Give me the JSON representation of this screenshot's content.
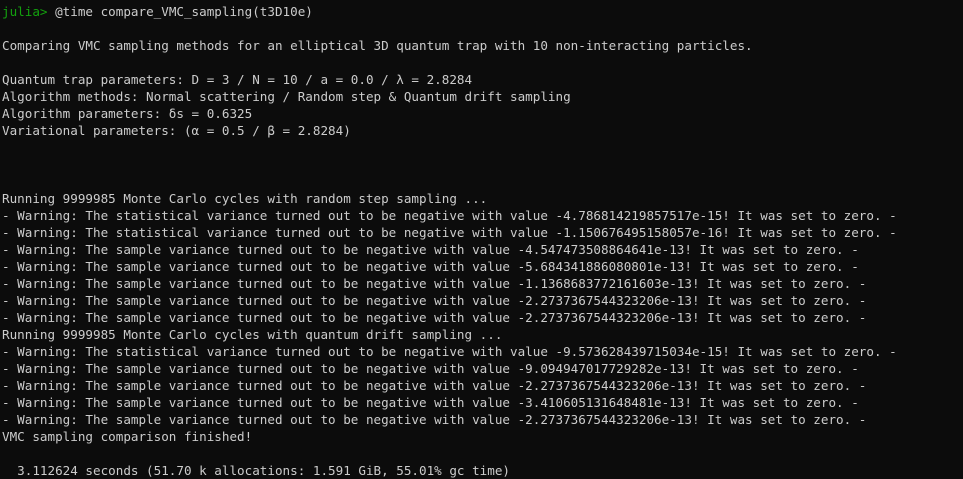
{
  "colors": {
    "background": "#0c0c0c",
    "foreground": "#cccccc",
    "prompt": "#13a10e"
  },
  "prompt": {
    "label": "julia>",
    "command": " @time compare_VMC_sampling(t3D10e)"
  },
  "intro": "Comparing VMC sampling methods for an elliptical 3D quantum trap with 10 non-interacting particles.",
  "params": {
    "trap": "Quantum trap parameters: D = 3 / N = 10 / a = 0.0 / λ = 2.8284",
    "methods": "Algorithm methods: Normal scattering / Random step & Quantum drift sampling",
    "algorithm": "Algorithm parameters: δs = 0.6325",
    "variational": "Variational parameters: (α = 0.5 / β = 2.8284)"
  },
  "run1": {
    "header": "Running 9999985 Monte Carlo cycles with random step sampling ...",
    "warnings": [
      "- Warning: The statistical variance turned out to be negative with value -4.786814219857517e-15! It was set to zero. -",
      "- Warning: The statistical variance turned out to be negative with value -1.150676495158057e-16! It was set to zero. -",
      "- Warning: The sample variance turned out to be negative with value -4.547473508864641e-13! It was set to zero. -",
      "- Warning: The sample variance turned out to be negative with value -5.684341886080801e-13! It was set to zero. -",
      "- Warning: The sample variance turned out to be negative with value -1.1368683772161603e-13! It was set to zero. -",
      "- Warning: The sample variance turned out to be negative with value -2.2737367544323206e-13! It was set to zero. -",
      "- Warning: The sample variance turned out to be negative with value -2.2737367544323206e-13! It was set to zero. -"
    ]
  },
  "run2": {
    "header": "Running 9999985 Monte Carlo cycles with quantum drift sampling ...",
    "warnings": [
      "- Warning: The statistical variance turned out to be negative with value -9.573628439715034e-15! It was set to zero. -",
      "- Warning: The sample variance turned out to be negative with value -9.094947017729282e-13! It was set to zero. -",
      "- Warning: The sample variance turned out to be negative with value -2.2737367544323206e-13! It was set to zero. -",
      "- Warning: The sample variance turned out to be negative with value -3.410605131648481e-13! It was set to zero. -",
      "- Warning: The sample variance turned out to be negative with value -2.2737367544323206e-13! It was set to zero. -"
    ]
  },
  "finished": "VMC sampling comparison finished!",
  "timing": "  3.112624 seconds (51.70 k allocations: 1.591 GiB, 55.01% gc time)"
}
